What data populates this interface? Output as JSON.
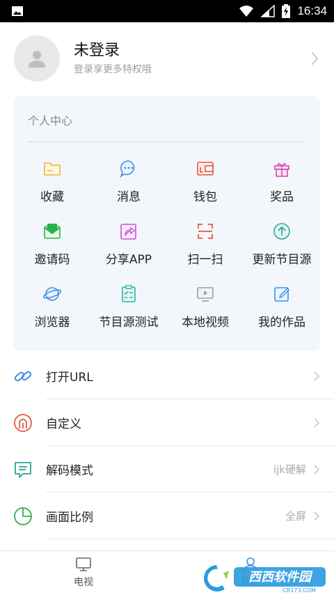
{
  "status_bar": {
    "time": "16:34",
    "icons": [
      "image-icon",
      "wifi-icon",
      "signal-icon",
      "battery-charging-icon"
    ]
  },
  "profile": {
    "name": "未登录",
    "subtitle": "登录享更多特权哦"
  },
  "personal_center": {
    "title": "个人中心",
    "items": [
      {
        "label": "收藏",
        "icon": "folder-icon",
        "color": "#f0b43a"
      },
      {
        "label": "消息",
        "icon": "message-icon",
        "color": "#3b8fe6"
      },
      {
        "label": "钱包",
        "icon": "wallet-icon",
        "color": "#e4583f"
      },
      {
        "label": "奖品",
        "icon": "gift-icon",
        "color": "#d84ab0"
      },
      {
        "label": "邀请码",
        "icon": "invite-mail-icon",
        "color": "#2bb24c"
      },
      {
        "label": "分享APP",
        "icon": "share-icon",
        "color": "#c950d8"
      },
      {
        "label": "扫一扫",
        "icon": "scan-icon",
        "color": "#e4583f"
      },
      {
        "label": "更新节目源",
        "icon": "update-icon",
        "color": "#26a69a"
      },
      {
        "label": "浏览器",
        "icon": "globe-icon",
        "color": "#3b8fe6"
      },
      {
        "label": "节目源测试",
        "icon": "checklist-icon",
        "color": "#2bb2a0"
      },
      {
        "label": "本地视频",
        "icon": "local-video-icon",
        "color": "#9aa0a6"
      },
      {
        "label": "我的作品",
        "icon": "edit-icon",
        "color": "#3b8fe6"
      }
    ]
  },
  "settings": [
    {
      "label": "打开URL",
      "value": "",
      "icon": "link-icon",
      "color": "#3b8fe6"
    },
    {
      "label": "自定义",
      "value": "",
      "icon": "custom-icon",
      "color": "#e4583f"
    },
    {
      "label": "解码模式",
      "value": "ijk硬解",
      "icon": "decode-icon",
      "color": "#26a69a"
    },
    {
      "label": "画面比例",
      "value": "全屏",
      "icon": "ratio-pie-icon",
      "color": "#2bb24c"
    }
  ],
  "bottom_nav": {
    "tv_label": "电视",
    "mine_label": "我的"
  },
  "watermark": {
    "text": "西西软件园",
    "url": "CR173.COM"
  }
}
